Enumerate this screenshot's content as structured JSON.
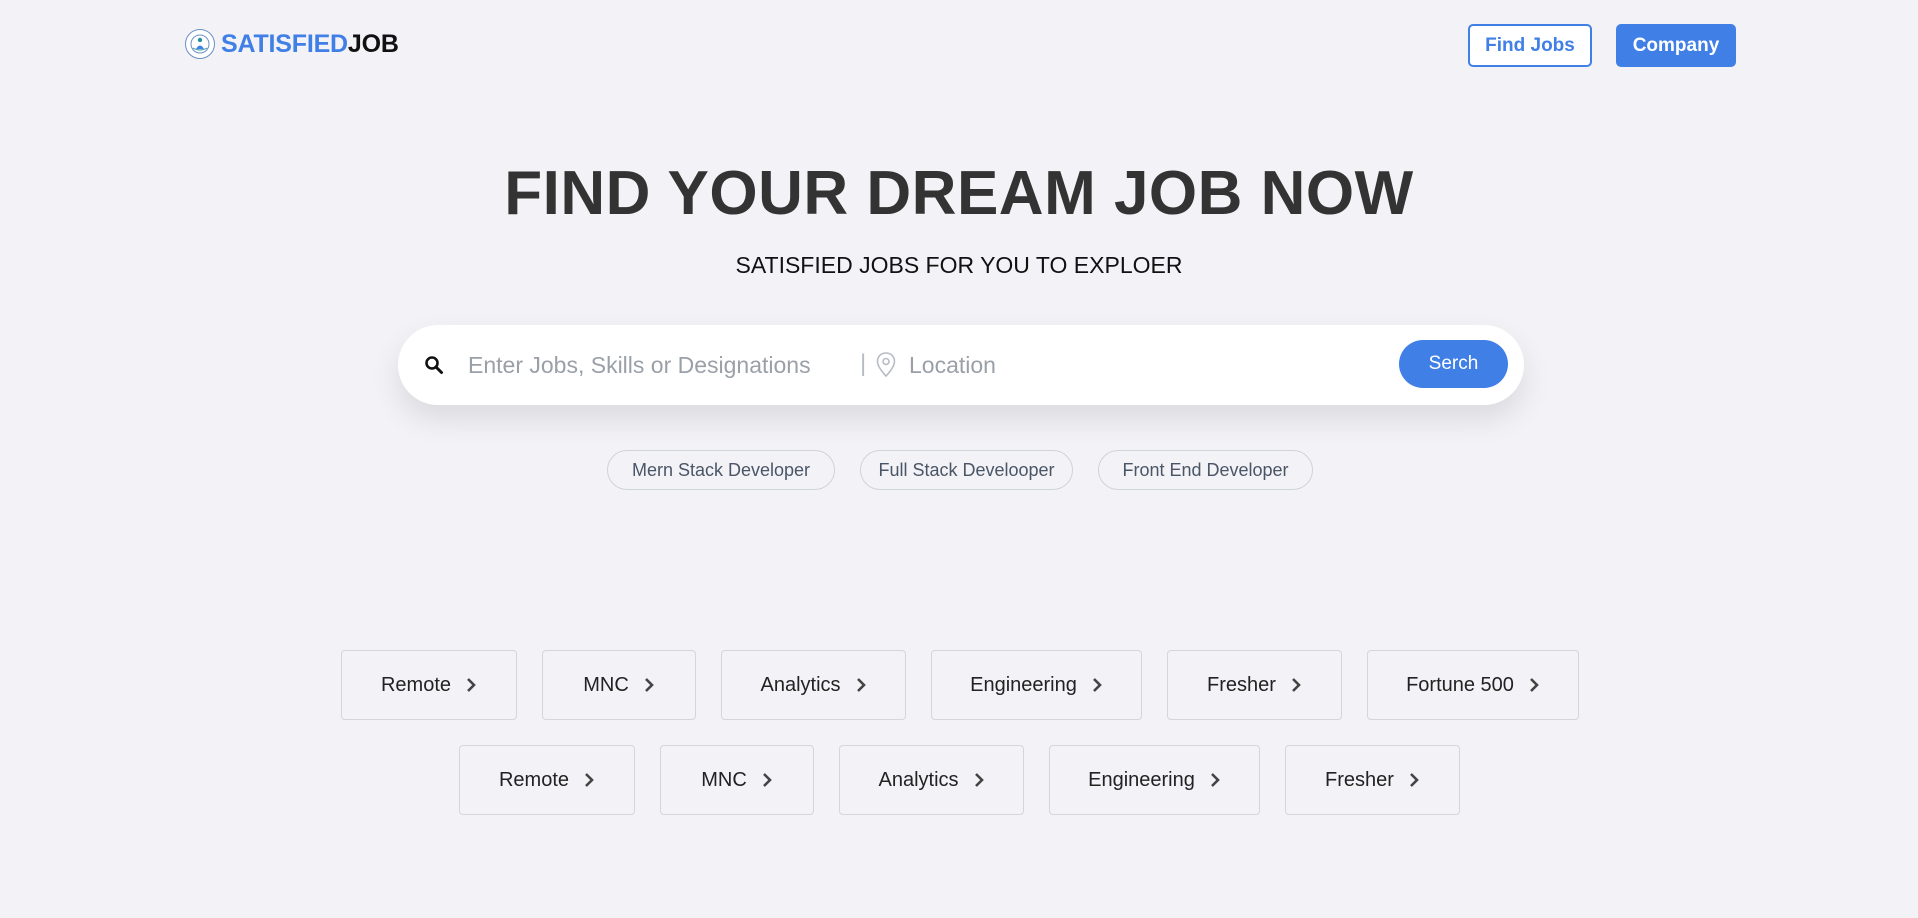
{
  "header": {
    "logo": {
      "part1": "SATISFIED",
      "part2": "JOB",
      "icon": "person-globe-icon"
    },
    "find_jobs_label": "Find Jobs",
    "company_label": "Company"
  },
  "hero": {
    "title": "FIND YOUR DREAM JOB NOW",
    "subtitle": "SATISFIED JOBS FOR YOU TO EXPLOER"
  },
  "search": {
    "job_placeholder": "Enter Jobs, Skills or Designations",
    "job_value": "",
    "divider": "|",
    "location_placeholder": "Location",
    "location_value": "",
    "button_label": "Serch",
    "icons": [
      "search-icon",
      "location-pin-icon"
    ]
  },
  "suggestions": [
    "Mern Stack Developer",
    "Full Stack Develooper",
    "Front End Developer"
  ],
  "categories_row1": [
    "Remote",
    "MNC",
    "Analytics",
    "Engineering",
    "Fresher",
    "Fortune 500"
  ],
  "categories_row2": [
    "Remote",
    "MNC",
    "Analytics",
    "Engineering",
    "Fresher"
  ],
  "colors": {
    "accent": "#3f7fe6",
    "background": "#f3f3f7",
    "title": "#333333"
  }
}
